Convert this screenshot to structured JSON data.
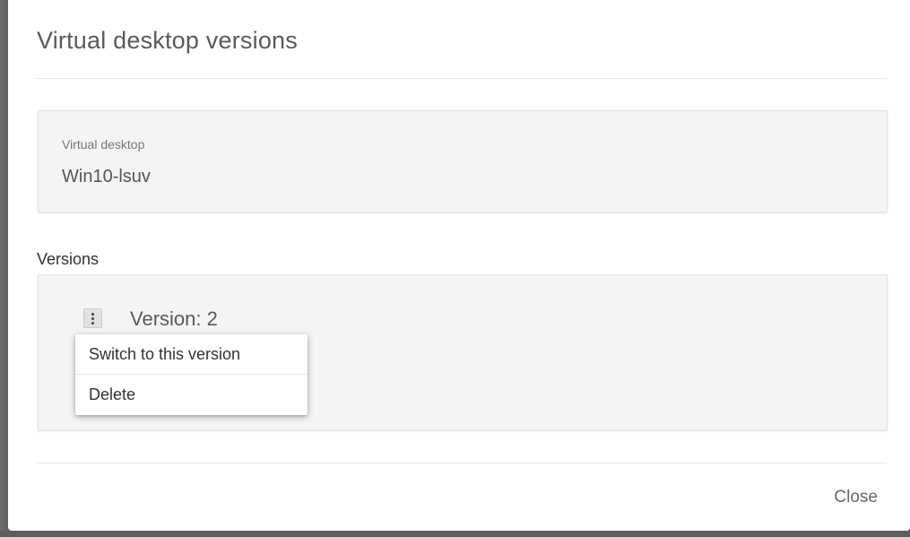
{
  "dialog": {
    "title": "Virtual desktop versions"
  },
  "info": {
    "label": "Virtual desktop",
    "value": "Win10-lsuv"
  },
  "versions": {
    "section_label": "Versions",
    "items": [
      {
        "label": "Version: 2"
      }
    ]
  },
  "context_menu": {
    "items": [
      {
        "label": "Switch to this version"
      },
      {
        "label": "Delete"
      }
    ]
  },
  "footer": {
    "close_label": "Close"
  },
  "icons": {
    "version_menu": "kebab-menu-icon"
  },
  "colors": {
    "dialog_background": "#ffffff",
    "card_background": "#f4f4f4",
    "backdrop": "#5a5a5a",
    "title_text": "#5a5a5a"
  }
}
